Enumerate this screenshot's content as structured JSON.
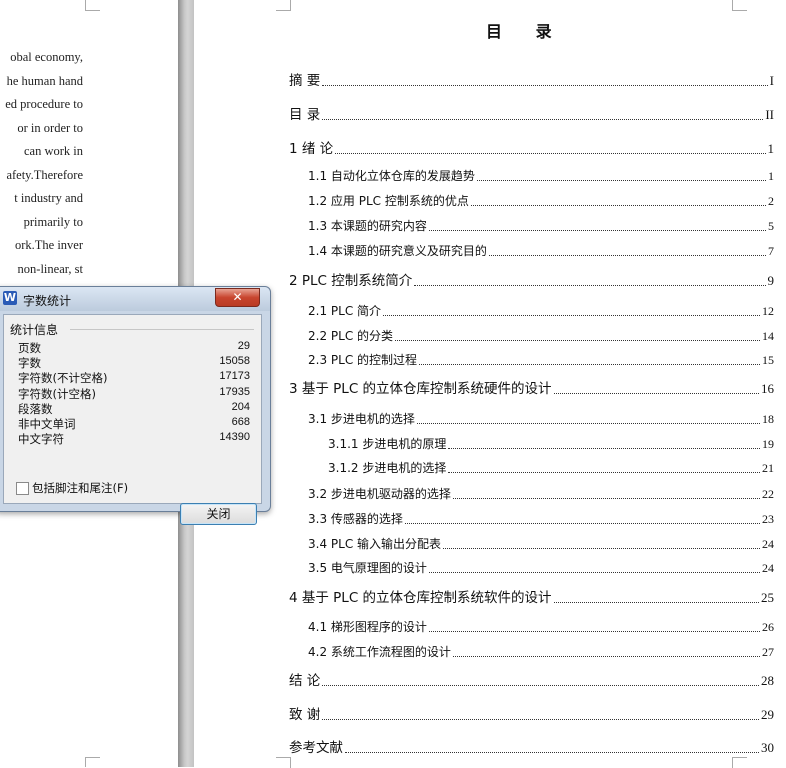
{
  "left_page": {
    "lines": [
      "obal economy,",
      "he human hand",
      "ed procedure to",
      "or  in  order  to",
      "can  work  in",
      "afety.Therefore",
      "t  industry  and",
      "primarily  to",
      "ork.The  inver",
      "non-linear,  st"
    ]
  },
  "toc": {
    "title": "目  录",
    "entries": [
      {
        "label": "摘      要",
        "page": "I",
        "level": 1
      },
      {
        "label": "目      录",
        "page": "II",
        "level": 1
      },
      {
        "label": "1  绪      论",
        "page": "1",
        "level": 1
      },
      {
        "label": "1.1 自动化立体仓库的发展趋势",
        "page": "1",
        "level": 2
      },
      {
        "label": "1.2 应用 PLC 控制系统的优点",
        "page": "2",
        "level": 2
      },
      {
        "label": "1.3 本课题的研究内容",
        "page": "5",
        "level": 2
      },
      {
        "label": "1.4 本课题的研究意义及研究目的",
        "page": "7",
        "level": 2
      },
      {
        "label": "2 PLC 控制系统简介",
        "page": "9",
        "level": 1
      },
      {
        "label": "2.1  PLC 简介",
        "page": "12",
        "level": 2
      },
      {
        "label": "2.2  PLC 的分类",
        "page": "14",
        "level": 2
      },
      {
        "label": "2.3  PLC 的控制过程",
        "page": "15",
        "level": 2
      },
      {
        "label": "3  基于 PLC 的立体仓库控制系统硬件的设计",
        "page": "16",
        "level": 1
      },
      {
        "label": "3.1  步进电机的选择",
        "page": "18",
        "level": 2
      },
      {
        "label": "3.1.1  步进电机的原理",
        "page": "19",
        "level": 3
      },
      {
        "label": "3.1.2  步进电机的选择",
        "page": "21",
        "level": 3
      },
      {
        "label": "3.2 步进电机驱动器的选择",
        "page": "22",
        "level": 2
      },
      {
        "label": "3.3 传感器的选择",
        "page": "23",
        "level": 2
      },
      {
        "label": "3.4  PLC  输入输出分配表",
        "page": "24",
        "level": 2
      },
      {
        "label": "3.5 电气原理图的设计",
        "page": "24",
        "level": 2
      },
      {
        "label": "4  基于 PLC 的立体仓库控制系统软件的设计",
        "page": "25",
        "level": 1
      },
      {
        "label": "4.1 梯形图程序的设计",
        "page": "26",
        "level": 2
      },
      {
        "label": "4.2 系统工作流程图的设计",
        "page": "27",
        "level": 2
      },
      {
        "label": "结      论",
        "page": "28",
        "level": 1
      },
      {
        "label": "致      谢",
        "page": "29",
        "level": 1
      },
      {
        "label": "参考文献",
        "page": "30",
        "level": 1
      }
    ]
  },
  "dialog": {
    "app_icon": "W",
    "title": "字数统计",
    "close_glyph": "✕",
    "group_label": "统计信息",
    "stats": [
      {
        "label": "页数",
        "value": "29"
      },
      {
        "label": "字数",
        "value": "15058"
      },
      {
        "label": "字符数(不计空格)",
        "value": "17173"
      },
      {
        "label": "字符数(计空格)",
        "value": "17935"
      },
      {
        "label": "段落数",
        "value": "204"
      },
      {
        "label": "非中文单词",
        "value": "668"
      },
      {
        "label": "中文字符",
        "value": "14390"
      }
    ],
    "footnote_checkbox_label": "包括脚注和尾注(F)",
    "footnote_checked": false,
    "close_button_label": "关闭"
  }
}
